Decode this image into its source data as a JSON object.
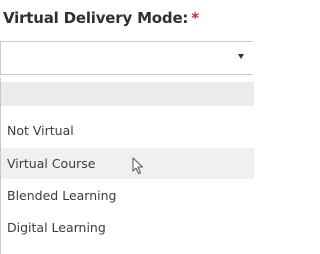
{
  "field": {
    "label": "Virtual Delivery Mode:",
    "required_marker": "*",
    "selected_value": ""
  },
  "dropdown": {
    "options": [
      "",
      "Not Virtual",
      "Virtual Course",
      "Blended Learning",
      "Digital Learning"
    ],
    "hovered_option": "Virtual Course"
  },
  "icons": {
    "select_arrow": "chevron-down-icon",
    "cursor": "mouse-pointer-icon"
  },
  "colors": {
    "required": "#d22b2b",
    "option_blank_bg": "#ebebeb",
    "option_hover_bg": "#f0f0f0",
    "border": "#c9c9c9"
  }
}
